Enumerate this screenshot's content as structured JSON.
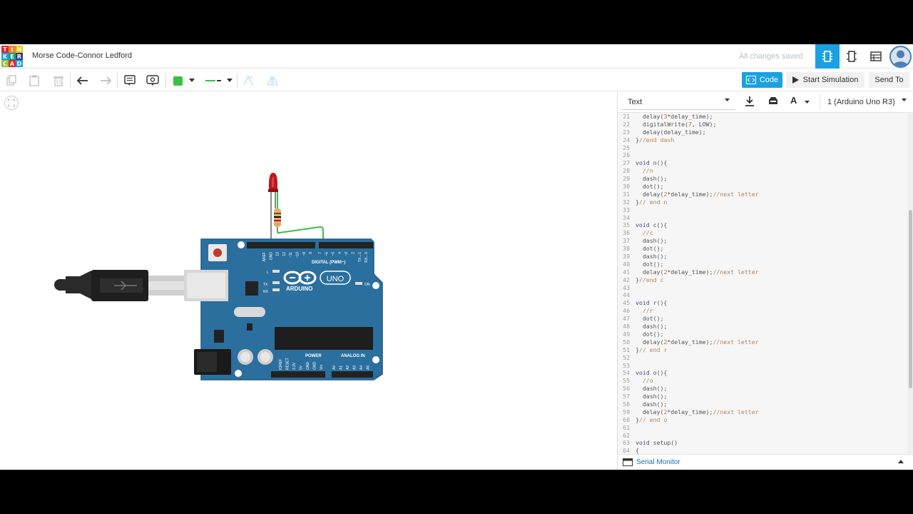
{
  "app": {
    "logo_letters": [
      "T",
      "I",
      "N",
      "K",
      "E",
      "R",
      "C",
      "A",
      "D"
    ],
    "logo_colors": [
      "#e5242a",
      "#f58025",
      "#f3c300",
      "#1ba1e2",
      "#16a085",
      "#2c3e91",
      "#8cc63e",
      "#e5242a",
      "#1ba1e2"
    ],
    "project_title": "Morse Code-Connor Ledford",
    "save_status": "All changes saved",
    "accent_color": "#1ba1e2"
  },
  "toolbar": {
    "icons": [
      "copy-icon",
      "paste-icon",
      "delete-icon",
      "undo-icon",
      "redo-icon",
      "notes-icon",
      "visibility-icon",
      "color-swatch",
      "wire-type-icon",
      "rotate-icon",
      "flip-icon"
    ],
    "selected_color": "#3cc143",
    "code_label": "Code",
    "start_simulation_label": "Start Simulation",
    "send_to_label": "Send To"
  },
  "code_panel": {
    "mode": "Text",
    "board": "1 (Arduino Uno R3)",
    "font_button": "A",
    "serial_monitor_label": "Serial Monitor",
    "lines": [
      {
        "n": "21",
        "t": "  delay(3*delay_time);"
      },
      {
        "n": "22",
        "t": "  digitalWrite(7, LOW);"
      },
      {
        "n": "23",
        "t": "  delay(delay_time);"
      },
      {
        "n": "24",
        "t": "}//end dash"
      },
      {
        "n": "25",
        "t": ""
      },
      {
        "n": "26",
        "t": ""
      },
      {
        "n": "27",
        "t": "void n(){"
      },
      {
        "n": "28",
        "t": "  //n"
      },
      {
        "n": "29",
        "t": "  dash();"
      },
      {
        "n": "30",
        "t": "  dot();"
      },
      {
        "n": "31",
        "t": "  delay(2*delay_time);//next letter"
      },
      {
        "n": "32",
        "t": "}// end n"
      },
      {
        "n": "33",
        "t": ""
      },
      {
        "n": "34",
        "t": ""
      },
      {
        "n": "35",
        "t": "void c(){"
      },
      {
        "n": "36",
        "t": "  //c"
      },
      {
        "n": "37",
        "t": "  dash();"
      },
      {
        "n": "38",
        "t": "  dot();"
      },
      {
        "n": "39",
        "t": "  dash();"
      },
      {
        "n": "40",
        "t": "  dot();"
      },
      {
        "n": "41",
        "t": "  delay(2*delay_time);//next letter"
      },
      {
        "n": "42",
        "t": "}//end c"
      },
      {
        "n": "43",
        "t": ""
      },
      {
        "n": "44",
        "t": ""
      },
      {
        "n": "45",
        "t": "void r(){"
      },
      {
        "n": "46",
        "t": "  //r"
      },
      {
        "n": "47",
        "t": "  dot();"
      },
      {
        "n": "48",
        "t": "  dash();"
      },
      {
        "n": "49",
        "t": "  dot();"
      },
      {
        "n": "50",
        "t": "  delay(2*delay_time);//next letter"
      },
      {
        "n": "51",
        "t": "}// end r"
      },
      {
        "n": "52",
        "t": ""
      },
      {
        "n": "53",
        "t": ""
      },
      {
        "n": "54",
        "t": "void o(){"
      },
      {
        "n": "55",
        "t": "  //o"
      },
      {
        "n": "56",
        "t": "  dash();"
      },
      {
        "n": "57",
        "t": "  dash();"
      },
      {
        "n": "58",
        "t": "  dash();"
      },
      {
        "n": "59",
        "t": "  delay(2*delay_time);//next letter"
      },
      {
        "n": "60",
        "t": "}// end o"
      },
      {
        "n": "61",
        "t": ""
      },
      {
        "n": "62",
        "t": ""
      },
      {
        "n": "63",
        "t": "void setup()"
      },
      {
        "n": "64",
        "t": "{"
      }
    ]
  },
  "board": {
    "brand": "ARDUINO",
    "model": "UNO",
    "digital_label": "DIGITAL (PWM~)",
    "power_label": "POWER",
    "analog_label": "ANALOG IN",
    "on_label": "ON",
    "tx_label": "TX",
    "rx_label": "RX",
    "l_label": "L",
    "digital_pins": [
      "AREF",
      "GND",
      "13",
      "12",
      "~11",
      "~10",
      "~9",
      "8",
      "7",
      "~6",
      "~5",
      "4",
      "~3",
      "2",
      "TX→1",
      "RX←0"
    ],
    "power_pins": [
      "IOREF",
      "RESET",
      "3.3V",
      "5V",
      "GND",
      "GND",
      "Vin"
    ],
    "analog_pins": [
      "A0",
      "A1",
      "A2",
      "A3",
      "A4",
      "A5"
    ],
    "board_color": "#2b6f9e",
    "led_color": "#c0151a",
    "wire_color": "#3cc143"
  }
}
